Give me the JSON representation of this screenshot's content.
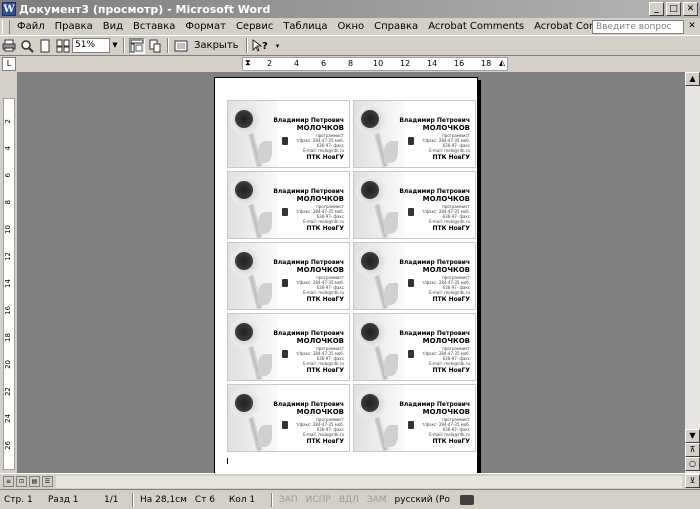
{
  "window": {
    "title": "Документ3 (просмотр) - Microsoft Word",
    "app_icon_letter": "W",
    "minimize": "_",
    "maximize": "□",
    "close": "✕"
  },
  "menu": {
    "items": [
      "Файл",
      "Правка",
      "Вид",
      "Вставка",
      "Формат",
      "Сервис",
      "Таблица",
      "Окно",
      "Справка",
      "Acrobat Comments",
      "Acrobat Comments"
    ],
    "help_placeholder": "Введите вопрос",
    "help_close": "✕"
  },
  "toolbar": {
    "zoom": "51%",
    "close_label": "Закрыть",
    "help_glyph": "?"
  },
  "ruler": {
    "h_ticks": [
      "2",
      "4",
      "6",
      "8",
      "10",
      "12",
      "14",
      "16",
      "18"
    ],
    "v_ticks": [
      "2",
      "4",
      "6",
      "8",
      "10",
      "12",
      "14",
      "16",
      "18",
      "20",
      "22",
      "24",
      "26"
    ]
  },
  "card": {
    "name": "Владимир Петрович",
    "surname": "МОЛОЧКОВ",
    "lines": [
      "программист",
      "т/факс: 284-47-35  моб.",
      "636-97-  факс",
      "E-mail: molo@ntk.ru"
    ],
    "org": "ПТК НовГУ",
    "count": 10
  },
  "scrollbar": {
    "up": "▲",
    "down": "▼",
    "prev_page": "⊼",
    "select_browse": "○",
    "next_page": "⊻"
  },
  "status": {
    "page": "Стр. 1",
    "section": "Разд 1",
    "pages": "1/1",
    "at": "На 28,1см",
    "line": "Ст 6",
    "col": "Кол 1",
    "rec": "ЗАП",
    "trk": "ИСПР",
    "ext": "ВДЛ",
    "ovr": "ЗАМ",
    "language": "русский (Ро"
  }
}
